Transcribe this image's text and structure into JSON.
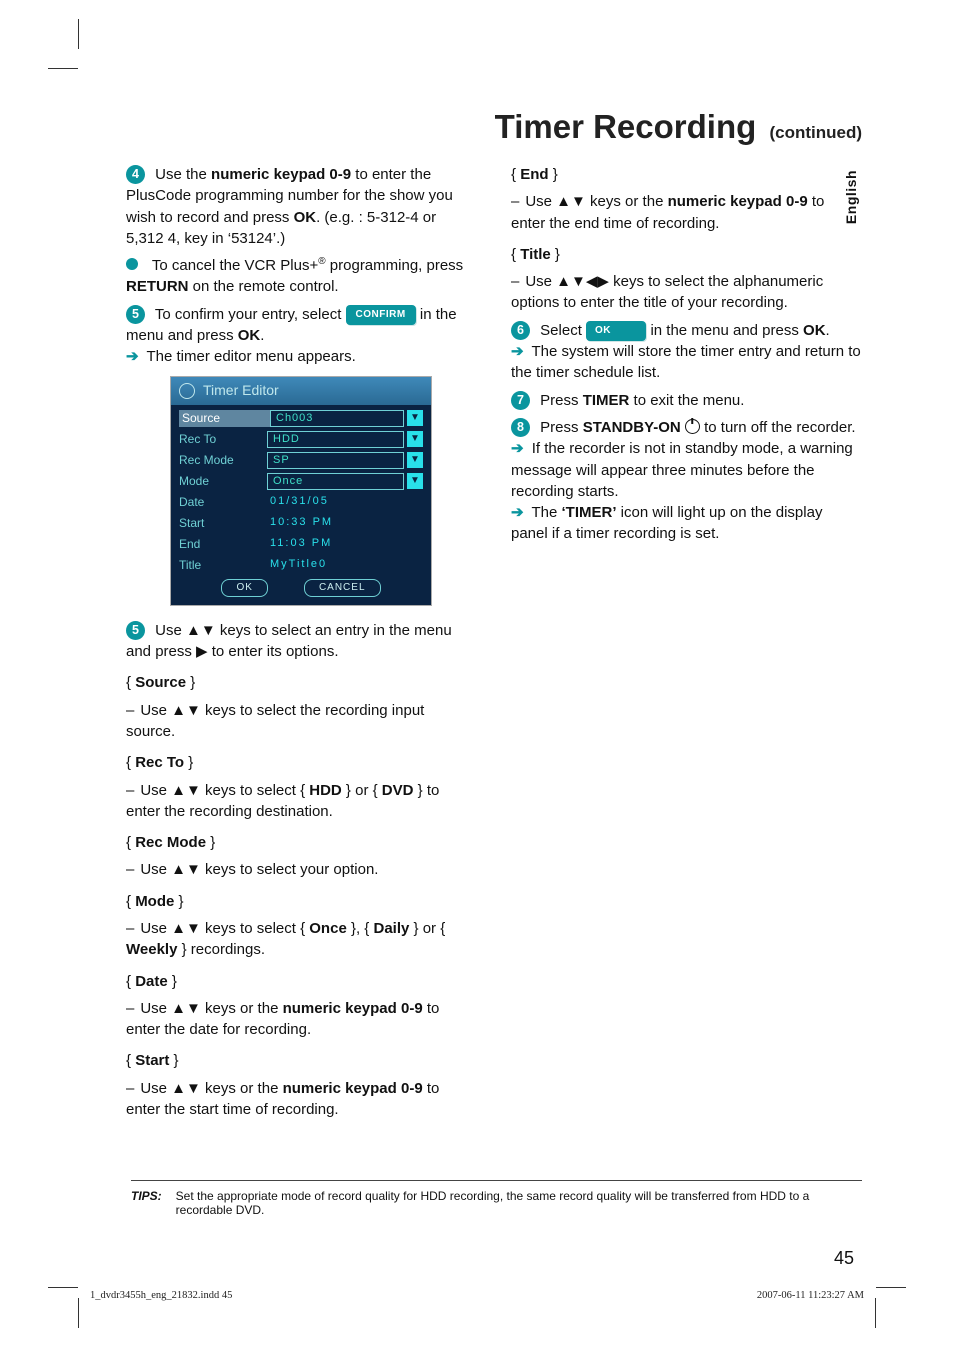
{
  "title": "Timer Recording ",
  "subtitle": "(continued)",
  "side_tab": "English",
  "page_number": "45",
  "tips_label": "TIPS:",
  "tips_text": "Set the appropriate mode of record quality for HDD recording, the same record quality will be transferred from HDD to a recordable DVD.",
  "buttons": {
    "confirm": "CONFIRM",
    "ok_pill": "OK"
  },
  "timer_editor": {
    "title": "Timer Editor",
    "rows": [
      {
        "label": "Source",
        "value": "Ch003",
        "box": true,
        "dd": true,
        "selected": true
      },
      {
        "label": "Rec To",
        "value": "HDD",
        "box": true,
        "dd": true
      },
      {
        "label": "Rec Mode",
        "value": "SP",
        "box": true,
        "dd": true
      },
      {
        "label": "Mode",
        "value": "Once",
        "box": true,
        "dd": true
      },
      {
        "label": "Date",
        "value": "01/31/05"
      },
      {
        "label": "Start",
        "value": "10:33 PM"
      },
      {
        "label": "End",
        "value": "11:03 PM"
      },
      {
        "label": "Title",
        "value": "MyTitle0"
      }
    ],
    "ok": "OK",
    "cancel": "CANCEL"
  },
  "left": {
    "s4a": "Use the ",
    "s4b": "numeric keypad 0-9",
    "s4c": " to enter the PlusCode programming number for the show you wish to record and press ",
    "s4d": "OK",
    "s4e": ". (e.g. : 5-312-4 or 5,312 4, key in ‘53124’.)",
    "cancel_a": "To cancel the VCR Plus+",
    "cancel_b": " programming, press ",
    "cancel_c": "RETURN",
    "cancel_d": " on the remote control.",
    "s5_pre_a": "To confirm your entry, select ",
    "s5_pre_b": " in the menu and press ",
    "s5_pre_c": "OK",
    "s5_pre_d": ".",
    "editor_appears": "The timer editor menu appears.",
    "s5b": "Use ▲▼ keys to select an entry in the menu and press ▶ to enter its options.",
    "f_source": "Source",
    "f_source_desc": "Use ▲▼ keys to select the recording input source.",
    "f_recto": "Rec To",
    "f_recto_desc_a": "Use ▲▼ keys to select { ",
    "f_recto_desc_b": "HDD",
    "f_recto_desc_c": " } or { ",
    "f_recto_desc_d": "DVD",
    "f_recto_desc_e": " } to enter the recording destination.",
    "f_recmode": "Rec Mode",
    "f_recmode_desc": "Use ▲▼ keys to select your option.",
    "f_mode": "Mode",
    "f_mode_desc_a": "Use ▲▼ keys to select { ",
    "f_mode_desc_b": "Once",
    "f_mode_desc_c": " }, { ",
    "f_mode_desc_d": "Daily",
    "f_mode_desc_e": " } or { ",
    "f_mode_desc_f": "Weekly",
    "f_mode_desc_g": " } recordings.",
    "f_date": "Date",
    "f_date_desc_a": "Use ▲▼ keys or the ",
    "f_date_desc_b": "numeric keypad 0-9",
    "f_date_desc_c": " to enter the date for recording.",
    "f_start": "Start",
    "f_start_desc_a": "Use ▲▼ keys or the ",
    "f_start_desc_b": "numeric keypad 0-9",
    "f_start_desc_c": " to enter the start time of recording."
  },
  "right": {
    "f_end": "End",
    "f_end_desc_a": "Use ▲▼ keys or the ",
    "f_end_desc_b": "numeric keypad 0-9",
    "f_end_desc_c": " to enter the end time of recording.",
    "f_title": "Title",
    "f_title_desc": "Use ▲▼◀▶ keys to select the alphanumeric options to enter the title of your recording.",
    "s6a": "Select ",
    "s6b": " in the menu and press ",
    "s6c": "OK",
    "s6d": ".",
    "s6_res": "The system will store the timer entry and return to the timer schedule list.",
    "s7a": "Press ",
    "s7b": "TIMER",
    "s7c": " to exit the menu.",
    "s8a": "Press ",
    "s8b": "STANDBY-ON",
    "s8c": " to turn off the recorder.",
    "s8_res1": "If the recorder is not in standby mode, a warning message will appear three minutes before the recording starts.",
    "s8_res2a": "The ",
    "s8_res2b": "‘TIMER’",
    "s8_res2c": " icon will light up on the display panel if a timer recording is set."
  },
  "footer": {
    "left": "1_dvdr3455h_eng_21832.indd   45",
    "right": "2007-06-11   11:23:27 AM"
  }
}
